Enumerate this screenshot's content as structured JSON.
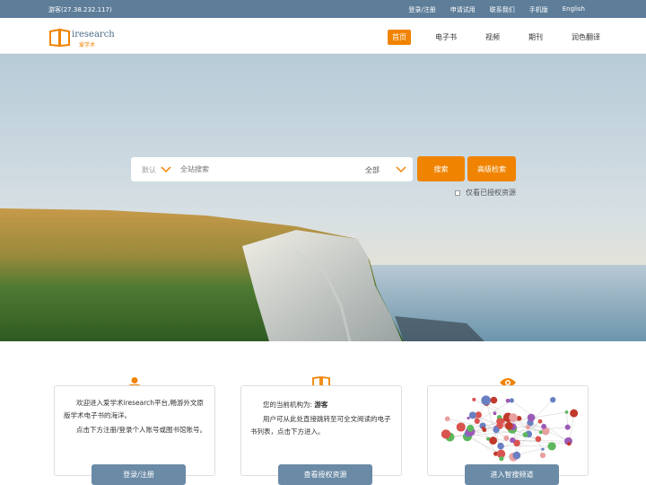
{
  "topbar": {
    "guest": "游客(27.38.232.117)",
    "links": [
      "登录/注册",
      "申请试用",
      "联系我们",
      "手机版",
      "English"
    ]
  },
  "header": {
    "logo_word": "iresearch",
    "logo_cn": "爱学术",
    "nav": [
      "首页",
      "电子书",
      "视频",
      "期刊",
      "润色翻译"
    ]
  },
  "search": {
    "mode": "默认",
    "placeholder": "全站搜索",
    "scope": "全部",
    "search_button": "搜索",
    "advanced_button": "高级检索",
    "only_authorized": "仅看已授权资源"
  },
  "cards": {
    "welcome": {
      "line1": "欢迎进入爱学术iresearch平台,畅游外文原版学术电子书的海洋。",
      "line2": "点击下方注册/登录个人账号或图书馆账号。",
      "button": "登录/注册"
    },
    "institution": {
      "prefix": "您的当前机构为: ",
      "name": "游客",
      "line2": "用户可从此处直接跳转至可全文阅读的电子书列表，点击下方进入。",
      "button": "查看授权资源"
    },
    "smart": {
      "button": "进入智搜频道"
    }
  },
  "colors": {
    "topbar": "#5d7d99",
    "accent": "#f08300",
    "card_button": "#6a8aa6"
  }
}
